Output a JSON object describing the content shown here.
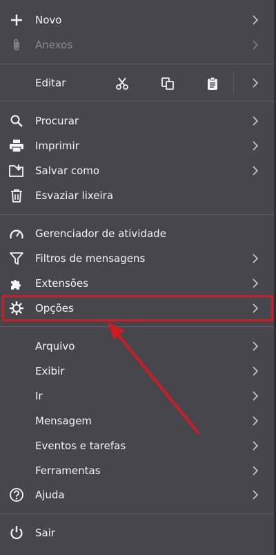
{
  "menu": {
    "items": [
      {
        "label": "Novo"
      },
      {
        "label": "Anexos"
      },
      {
        "label": "Editar"
      },
      {
        "label": "Procurar"
      },
      {
        "label": "Imprimir"
      },
      {
        "label": "Salvar como"
      },
      {
        "label": "Esvaziar lixeira"
      },
      {
        "label": "Gerenciador de atividade"
      },
      {
        "label": "Filtros de mensagens"
      },
      {
        "label": "Extensões"
      },
      {
        "label": "Opções"
      },
      {
        "label": "Arquivo"
      },
      {
        "label": "Exibir"
      },
      {
        "label": "Ir"
      },
      {
        "label": "Mensagem"
      },
      {
        "label": "Eventos e tarefas"
      },
      {
        "label": "Ferramentas"
      },
      {
        "label": "Ajuda"
      },
      {
        "label": "Sair"
      }
    ]
  },
  "annotation": {
    "highlight_color": "#d01b23",
    "highlighted_item": "Opções"
  },
  "colors": {
    "menu_background": "#47464c",
    "text": "#f4f4f5",
    "disabled_text": "#8b8a90",
    "separator": "#5d5c62"
  }
}
